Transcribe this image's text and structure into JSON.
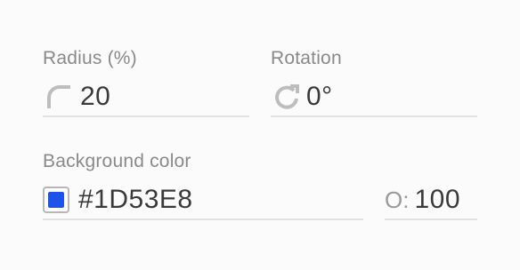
{
  "radius": {
    "label": "Radius (%)",
    "value": "20",
    "icon": "corner-radius-icon"
  },
  "rotation": {
    "label": "Rotation",
    "value": "0°",
    "icon": "rotate-icon"
  },
  "background": {
    "label": "Background color",
    "hex": "#1D53E8",
    "color": "#1D53E8",
    "opacity_icon": "O:",
    "opacity_value": "100"
  }
}
